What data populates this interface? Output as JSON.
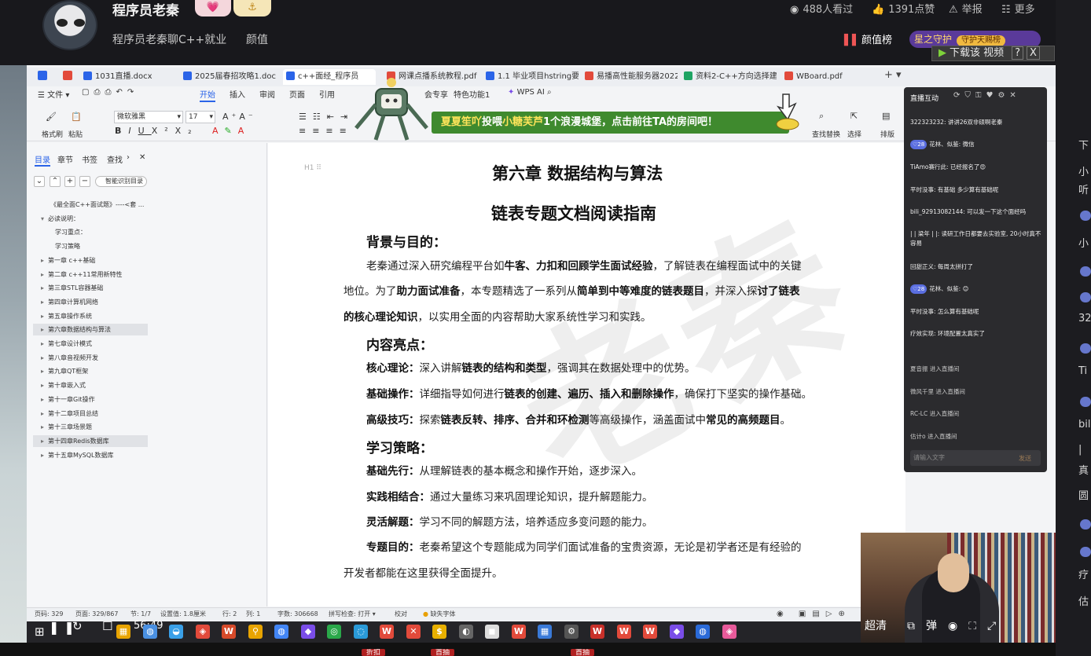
{
  "stream": {
    "streamer_name": "程序员老秦",
    "badge_1": "💗",
    "badge_2": "⚓",
    "subtitle": "程序员老秦聊C++就业",
    "category": "颜值",
    "viewers": "488人看过",
    "likes": "1391点赞",
    "report": "举报",
    "more": "更多",
    "rank_label": "颜值榜",
    "guard_text": "星之守护",
    "guard_pill": "守护天赐榜"
  },
  "downloader": {
    "label": "下载该 视频",
    "q": "?",
    "close": "X"
  },
  "wps": {
    "tabs": [
      {
        "label": "1031直播.docx",
        "color": "#2b64e8"
      },
      {
        "label": "2025届春招攻略1.doc",
        "color": "#2b64e8"
      },
      {
        "label": "c++面经_程序员",
        "color": "#2b64e8"
      },
      {
        "label": "网课点播系统教程.pdf",
        "color": "#e24a3b"
      },
      {
        "label": "1.1 毕业项目hstring要求",
        "color": "#2b64e8"
      },
      {
        "label": "易播高性能服务器202201",
        "color": "#e24a3b"
      },
      {
        "label": "资料2-C++方向选择建议",
        "color": "#1fa463"
      },
      {
        "label": "WBoard.pdf",
        "color": "#e24a3b"
      }
    ],
    "menu": {
      "file": "文件",
      "home": "开始",
      "insert": "插入",
      "review": "审阅",
      "page": "页面",
      "ref": "引用",
      "special": "会专享",
      "feature": "特色功能1",
      "ai": "WPS AI"
    },
    "ribbon": {
      "format_painter": "格式刷",
      "paste": "粘贴",
      "font": "微软雅黑",
      "size": "17",
      "find_replace": "查找替换",
      "select": "选择",
      "layout": "排版"
    },
    "nav": {
      "tab_toc": "目录",
      "tab_chapter": "章节",
      "tab_bookmark": "书签",
      "tab_find": "查找",
      "smart_toc": "智能识别目录",
      "items": [
        {
          "label": "《最全面C++面试题》----<套 ...",
          "arrow": "",
          "indent": 0
        },
        {
          "label": "必读说明：",
          "arrow": "▾",
          "indent": 0
        },
        {
          "label": "学习重点：",
          "arrow": "",
          "indent": 1
        },
        {
          "label": "学习策略",
          "arrow": "",
          "indent": 1
        },
        {
          "label": "第一章 c++基础",
          "arrow": "▸",
          "indent": 0
        },
        {
          "label": "第二章 c++11常用新特性",
          "arrow": "▸",
          "indent": 0
        },
        {
          "label": "第三章STL容器基础",
          "arrow": "▸",
          "indent": 0
        },
        {
          "label": "第四章计算机网络",
          "arrow": "▸",
          "indent": 0
        },
        {
          "label": "第五章操作系统",
          "arrow": "▸",
          "indent": 0
        },
        {
          "label": "第六章数据结构与算法",
          "arrow": "▸",
          "indent": 0
        },
        {
          "label": "第七章设计模式",
          "arrow": "▸",
          "indent": 0
        },
        {
          "label": "第八章音视频开发",
          "arrow": "▸",
          "indent": 0
        },
        {
          "label": "第九章QT框架",
          "arrow": "▸",
          "indent": 0
        },
        {
          "label": "第十章嵌入式",
          "arrow": "▸",
          "indent": 0
        },
        {
          "label": "第十一章Git操作",
          "arrow": "▸",
          "indent": 0
        },
        {
          "label": "第十二章项目总结",
          "arrow": "▸",
          "indent": 0
        },
        {
          "label": "第十三章场景题",
          "arrow": "▸",
          "indent": 0
        },
        {
          "label": "第十四章Redis数据库",
          "arrow": "▸",
          "indent": 0
        },
        {
          "label": "第十五章MySQL数据库",
          "arrow": "▸",
          "indent": 0
        }
      ]
    },
    "doc": {
      "mark": "H1 ⠿",
      "title": "第六章  数据结构与算法",
      "subtitle": "链表专题文档阅读指南",
      "h_bg": "背景与目的：",
      "bg_l1": "老秦通过深入研究编程平台如<b>牛客、力扣和回顾学生面试经验</b>，了解链表在编程面试中的关键",
      "bg_l2": "地位。为了<b>助力面试准备</b>，本专题精选了一系列从<b>简单到中等难度的链表题目</b>，并深入探<b>讨了链表</b>",
      "bg_l3": "<b>的核心理论知识</b>，以实用全面的内容帮助大家系统性学习和实践。",
      "h_hl": "内容亮点：",
      "hl_1": "<b>核心理论：</b>深入讲解<b>链表的结构和类型</b>，强调其在数据处理中的优势。",
      "hl_2": "<b>基础操作：</b>详细指导如何进行<b>链表的创建、遍历、插入和删除操作</b>，确保打下坚实的操作基础。",
      "hl_3": "<b>高级技巧：</b>探索<b>链表反转、排序、合并和环检测</b>等高级操作，涵盖面试中<b>常见的高频题目</b>。",
      "h_st": "学习策略：",
      "st_1": "<b>基础先行：</b>从理解链表的基本概念和操作开始，逐步深入。",
      "st_2": "<b>实践相结合：</b>通过大量练习来巩固理论知识，提升解题能力。",
      "st_3": "<b>灵活解题：</b>学习不同的解题方法，培养适应多变问题的能力。",
      "st_4": "<b>专题目的：</b>老秦希望这个专题能成为同学们面试准备的宝贵资源，无论是初学者还是有经验的",
      "st_5": "开发者都能在这里获得全面提升。",
      "watermark": "老秦"
    },
    "status": {
      "page": "页码: 329",
      "pages": "页面: 329/867",
      "section": "节: 1/7",
      "setting": "设置值: 1.8厘米",
      "row": "行: 2",
      "col": "列: 1",
      "words": "字数: 306668",
      "spell": "拼写检查: 打开 ▾",
      "proof": "校对",
      "font_missing": "缺失字体"
    }
  },
  "banner": {
    "user": "夏夏笙吖",
    "action": "投喂",
    "target": "小糖芙芦",
    "rest": "1个浪漫城堡，点击前往TA的房间吧！"
  },
  "chat": {
    "title": "直播互动",
    "messages": [
      {
        "lv": "",
        "text": "322323232: 讲讲26双非硕啊老秦"
      },
      {
        "lv": "28",
        "text": "花林、似鉴: 微信"
      },
      {
        "lv": "",
        "text": "TiAmo赛行此: 已经报名了😍"
      },
      {
        "lv": "",
        "text": "平时没事: 有基础 多少算有基础呢"
      },
      {
        "lv": "",
        "text": "bili_92913082144: 可以发一下这个面经吗"
      },
      {
        "lv": "",
        "text": "| | 梁年 | |: 读研工作日都要去实验室, 20小时真不容易"
      },
      {
        "lv": "",
        "text": "回甜正义: 每周太拼打了"
      },
      {
        "lv": "28",
        "text": "花林、似鉴: 😊"
      },
      {
        "lv": "",
        "text": "平时没事: 怎么算有基础呢"
      },
      {
        "lv": "",
        "text": "疗效实现: 环境配置太真实了"
      },
      {
        "lv": "",
        "text": "夏音振 进入直播间"
      },
      {
        "lv": "",
        "text": "微风千里 进入直播间"
      },
      {
        "lv": "",
        "text": "RC-LC 进入直播间"
      },
      {
        "lv": "",
        "text": "估计o 进入直播间"
      }
    ],
    "input_placeholder": "请输入文字",
    "send": "发送"
  },
  "player": {
    "clock": "56:49",
    "quality": "超清"
  },
  "right_strip": [
    "下",
    "小",
    "听",
    "小",
    "32",
    "Ti",
    "bil",
    "|",
    "真",
    "圆",
    "疗",
    "估"
  ],
  "bottom_tags": [
    "折扣",
    "首抽",
    "首抽"
  ]
}
